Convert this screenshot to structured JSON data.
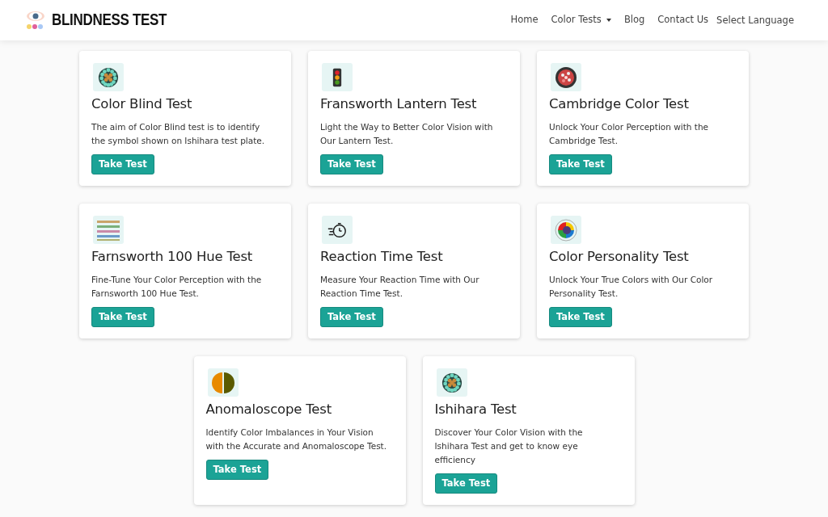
{
  "header": {
    "logo_text": "BLINDNESS TEST",
    "nav": [
      {
        "label": "Home",
        "kind": "link"
      },
      {
        "label": "Color Tests",
        "kind": "dropdown"
      },
      {
        "label": "Blog",
        "kind": "link"
      },
      {
        "label": "Contact Us",
        "kind": "link"
      },
      {
        "label": "Select Language",
        "kind": "plain"
      }
    ]
  },
  "cards": [
    {
      "kind": "plate",
      "title": "Color Blind Test",
      "description": "The aim of Color Blind test is to identify the symbol shown on Ishihara test plate.",
      "button": "Take Test"
    },
    {
      "kind": "traffic-light",
      "title": "Fransworth Lantern Test",
      "description": "Light the Way to Better Color Vision with Our Lantern Test.",
      "button": "Take Test"
    },
    {
      "kind": "cambridge",
      "title": "Cambridge Color Test",
      "description": "Unlock Your Color Perception with the Cambridge Test.",
      "button": "Take Test"
    },
    {
      "kind": "hue-bars",
      "title": "Farnsworth 100 Hue Test",
      "description": "Fine-Tune Your Color Perception with the Farnsworth 100 Hue Test.",
      "button": "Take Test"
    },
    {
      "kind": "stopwatch",
      "title": "Reaction Time Test",
      "description": "Measure Your Reaction Time with Our Reaction Time Test.",
      "button": "Take Test"
    },
    {
      "kind": "color-wheel",
      "title": "Color Personality Test",
      "description": "Unlock Your True Colors with Our Color Personality Test.",
      "button": "Take Test"
    },
    {
      "kind": "split-circle",
      "title": "Anomaloscope Test",
      "description": "Identify Color Imbalances in Your Vision with the Accurate and Anomaloscope Test.",
      "button": "Take Test"
    },
    {
      "kind": "plate",
      "title": "Ishihara Test",
      "description": "Discover Your Color Vision with the Ishihara Test and get to know eye efficiency",
      "button": "Take Test"
    }
  ]
}
